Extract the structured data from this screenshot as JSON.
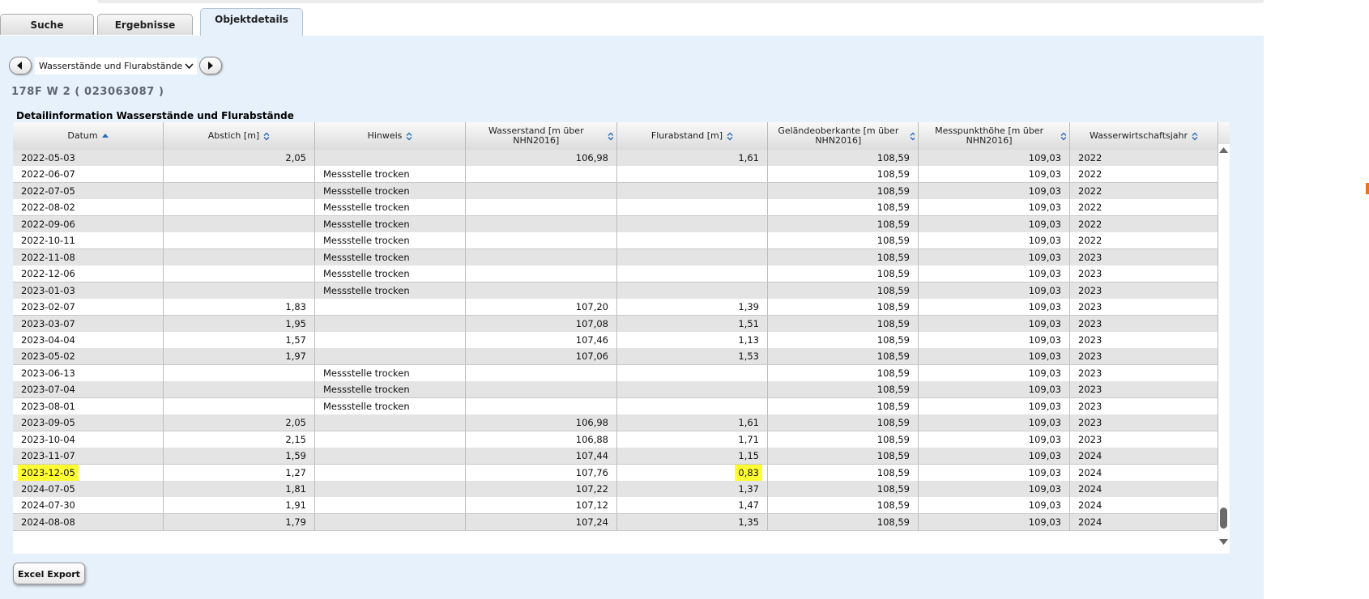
{
  "tabs": [
    {
      "label": "Suche"
    },
    {
      "label": "Ergebnisse"
    },
    {
      "label": "Objektdetails"
    }
  ],
  "selector": {
    "value": "Wasserstände und Flurabstände"
  },
  "object_id": "178F W 2 ( 023063087 )",
  "table_title": "Detailinformation Wasserstände und Flurabstände",
  "columns": [
    {
      "label": "Datum",
      "sort": "asc"
    },
    {
      "label": "Abstich [m]",
      "sort": "both"
    },
    {
      "label": "Hinweis",
      "sort": "both"
    },
    {
      "label": "Wasserstand [m über NHN2016]",
      "sort": "both"
    },
    {
      "label": "Flurabstand [m]",
      "sort": "both"
    },
    {
      "label": "Geländeoberkante [m über NHN2016]",
      "sort": "both"
    },
    {
      "label": "Messpunkthöhe [m über NHN2016]",
      "sort": "both"
    },
    {
      "label": "Wasserwirtschaftsjahr",
      "sort": "both"
    }
  ],
  "rows": [
    {
      "datum": "2022-05-03",
      "abstich": "2,05",
      "hinweis": "",
      "wasserstand": "106,98",
      "flurabstand": "1,61",
      "gok": "108,59",
      "mph": "109,03",
      "wwj": "2022"
    },
    {
      "datum": "2022-06-07",
      "abstich": "",
      "hinweis": "Messstelle trocken",
      "wasserstand": "",
      "flurabstand": "",
      "gok": "108,59",
      "mph": "109,03",
      "wwj": "2022"
    },
    {
      "datum": "2022-07-05",
      "abstich": "",
      "hinweis": "Messstelle trocken",
      "wasserstand": "",
      "flurabstand": "",
      "gok": "108,59",
      "mph": "109,03",
      "wwj": "2022"
    },
    {
      "datum": "2022-08-02",
      "abstich": "",
      "hinweis": "Messstelle trocken",
      "wasserstand": "",
      "flurabstand": "",
      "gok": "108,59",
      "mph": "109,03",
      "wwj": "2022"
    },
    {
      "datum": "2022-09-06",
      "abstich": "",
      "hinweis": "Messstelle trocken",
      "wasserstand": "",
      "flurabstand": "",
      "gok": "108,59",
      "mph": "109,03",
      "wwj": "2022"
    },
    {
      "datum": "2022-10-11",
      "abstich": "",
      "hinweis": "Messstelle trocken",
      "wasserstand": "",
      "flurabstand": "",
      "gok": "108,59",
      "mph": "109,03",
      "wwj": "2022"
    },
    {
      "datum": "2022-11-08",
      "abstich": "",
      "hinweis": "Messstelle trocken",
      "wasserstand": "",
      "flurabstand": "",
      "gok": "108,59",
      "mph": "109,03",
      "wwj": "2023"
    },
    {
      "datum": "2022-12-06",
      "abstich": "",
      "hinweis": "Messstelle trocken",
      "wasserstand": "",
      "flurabstand": "",
      "gok": "108,59",
      "mph": "109,03",
      "wwj": "2023"
    },
    {
      "datum": "2023-01-03",
      "abstich": "",
      "hinweis": "Messstelle trocken",
      "wasserstand": "",
      "flurabstand": "",
      "gok": "108,59",
      "mph": "109,03",
      "wwj": "2023"
    },
    {
      "datum": "2023-02-07",
      "abstich": "1,83",
      "hinweis": "",
      "wasserstand": "107,20",
      "flurabstand": "1,39",
      "gok": "108,59",
      "mph": "109,03",
      "wwj": "2023"
    },
    {
      "datum": "2023-03-07",
      "abstich": "1,95",
      "hinweis": "",
      "wasserstand": "107,08",
      "flurabstand": "1,51",
      "gok": "108,59",
      "mph": "109,03",
      "wwj": "2023"
    },
    {
      "datum": "2023-04-04",
      "abstich": "1,57",
      "hinweis": "",
      "wasserstand": "107,46",
      "flurabstand": "1,13",
      "gok": "108,59",
      "mph": "109,03",
      "wwj": "2023"
    },
    {
      "datum": "2023-05-02",
      "abstich": "1,97",
      "hinweis": "",
      "wasserstand": "107,06",
      "flurabstand": "1,53",
      "gok": "108,59",
      "mph": "109,03",
      "wwj": "2023"
    },
    {
      "datum": "2023-06-13",
      "abstich": "",
      "hinweis": "Messstelle trocken",
      "wasserstand": "",
      "flurabstand": "",
      "gok": "108,59",
      "mph": "109,03",
      "wwj": "2023"
    },
    {
      "datum": "2023-07-04",
      "abstich": "",
      "hinweis": "Messstelle trocken",
      "wasserstand": "",
      "flurabstand": "",
      "gok": "108,59",
      "mph": "109,03",
      "wwj": "2023"
    },
    {
      "datum": "2023-08-01",
      "abstich": "",
      "hinweis": "Messstelle trocken",
      "wasserstand": "",
      "flurabstand": "",
      "gok": "108,59",
      "mph": "109,03",
      "wwj": "2023"
    },
    {
      "datum": "2023-09-05",
      "abstich": "2,05",
      "hinweis": "",
      "wasserstand": "106,98",
      "flurabstand": "1,61",
      "gok": "108,59",
      "mph": "109,03",
      "wwj": "2023"
    },
    {
      "datum": "2023-10-04",
      "abstich": "2,15",
      "hinweis": "",
      "wasserstand": "106,88",
      "flurabstand": "1,71",
      "gok": "108,59",
      "mph": "109,03",
      "wwj": "2023"
    },
    {
      "datum": "2023-11-07",
      "abstich": "1,59",
      "hinweis": "",
      "wasserstand": "107,44",
      "flurabstand": "1,15",
      "gok": "108,59",
      "mph": "109,03",
      "wwj": "2024"
    },
    {
      "datum": "2023-12-05",
      "abstich": "1,27",
      "hinweis": "",
      "wasserstand": "107,76",
      "flurabstand": "0,83",
      "gok": "108,59",
      "mph": "109,03",
      "wwj": "2024",
      "highlight": true
    },
    {
      "datum": "2024-07-05",
      "abstich": "1,81",
      "hinweis": "",
      "wasserstand": "107,22",
      "flurabstand": "1,37",
      "gok": "108,59",
      "mph": "109,03",
      "wwj": "2024"
    },
    {
      "datum": "2024-07-30",
      "abstich": "1,91",
      "hinweis": "",
      "wasserstand": "107,12",
      "flurabstand": "1,47",
      "gok": "108,59",
      "mph": "109,03",
      "wwj": "2024"
    },
    {
      "datum": "2024-08-08",
      "abstich": "1,79",
      "hinweis": "",
      "wasserstand": "107,24",
      "flurabstand": "1,35",
      "gok": "108,59",
      "mph": "109,03",
      "wwj": "2024"
    }
  ],
  "export_button": {
    "label": "Excel Export"
  },
  "colors": {
    "highlight": "#ffff33",
    "panel": "#e7f1fb",
    "row_alt": "#e4e4e4"
  }
}
